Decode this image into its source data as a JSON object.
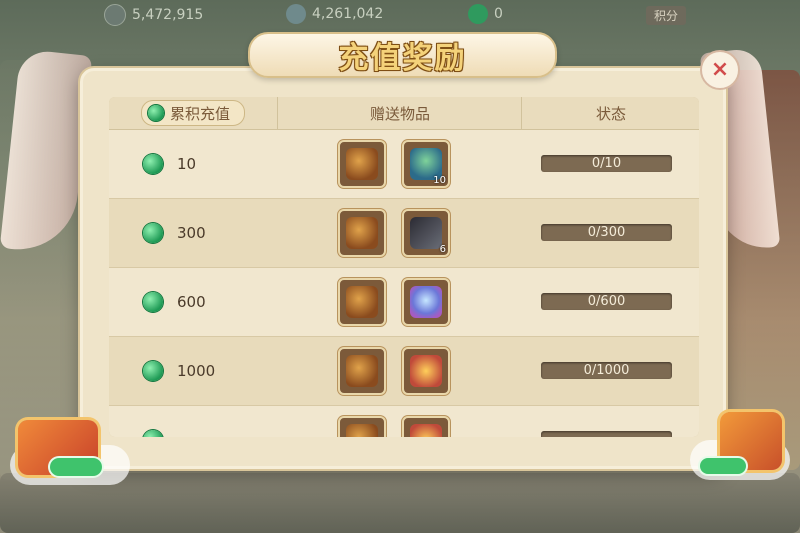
{
  "topbar": {
    "currency1": {
      "icon": "silver-coin-icon",
      "value": "5,472,915"
    },
    "currency2": {
      "icon": "ingot-icon",
      "value": "4,261,042"
    },
    "currency3": {
      "icon": "jade-icon",
      "value": "0"
    },
    "score_label": "积分"
  },
  "dialog": {
    "title": "充值奖励",
    "close_glyph": "×"
  },
  "table": {
    "headers": {
      "cumulative": "累积充值",
      "gifts": "赠送物品",
      "status": "状态"
    },
    "rows": [
      {
        "amount": "10",
        "item1": "silver-ingot-bag-icon",
        "item2": "jade-vase-icon",
        "item2_qty": "10",
        "progress_text": "0/10",
        "progress": 0
      },
      {
        "amount": "300",
        "item1": "silver-ingot-bag-icon",
        "item2": "dark-blade-icon",
        "item2_qty": "6",
        "progress_text": "0/300",
        "progress": 0
      },
      {
        "amount": "600",
        "item1": "silver-ingot-bag-icon",
        "item2": "crystal-orb-icon",
        "item2_qty": "",
        "progress_text": "0/600",
        "progress": 0
      },
      {
        "amount": "1000",
        "item1": "silver-ingot-bag-icon",
        "item2": "lucky-pouch-icon",
        "item2_qty": "",
        "progress_text": "0/1000",
        "progress": 0
      },
      {
        "amount": "",
        "item1": "silver-ingot-bag-icon",
        "item2": "lucky-pouch-icon",
        "item2_qty": "",
        "progress_text": "",
        "progress": 0
      }
    ]
  },
  "colors": {
    "accent": "#f4d27a",
    "jade": "#1e9a55",
    "close": "#d14b4b"
  }
}
